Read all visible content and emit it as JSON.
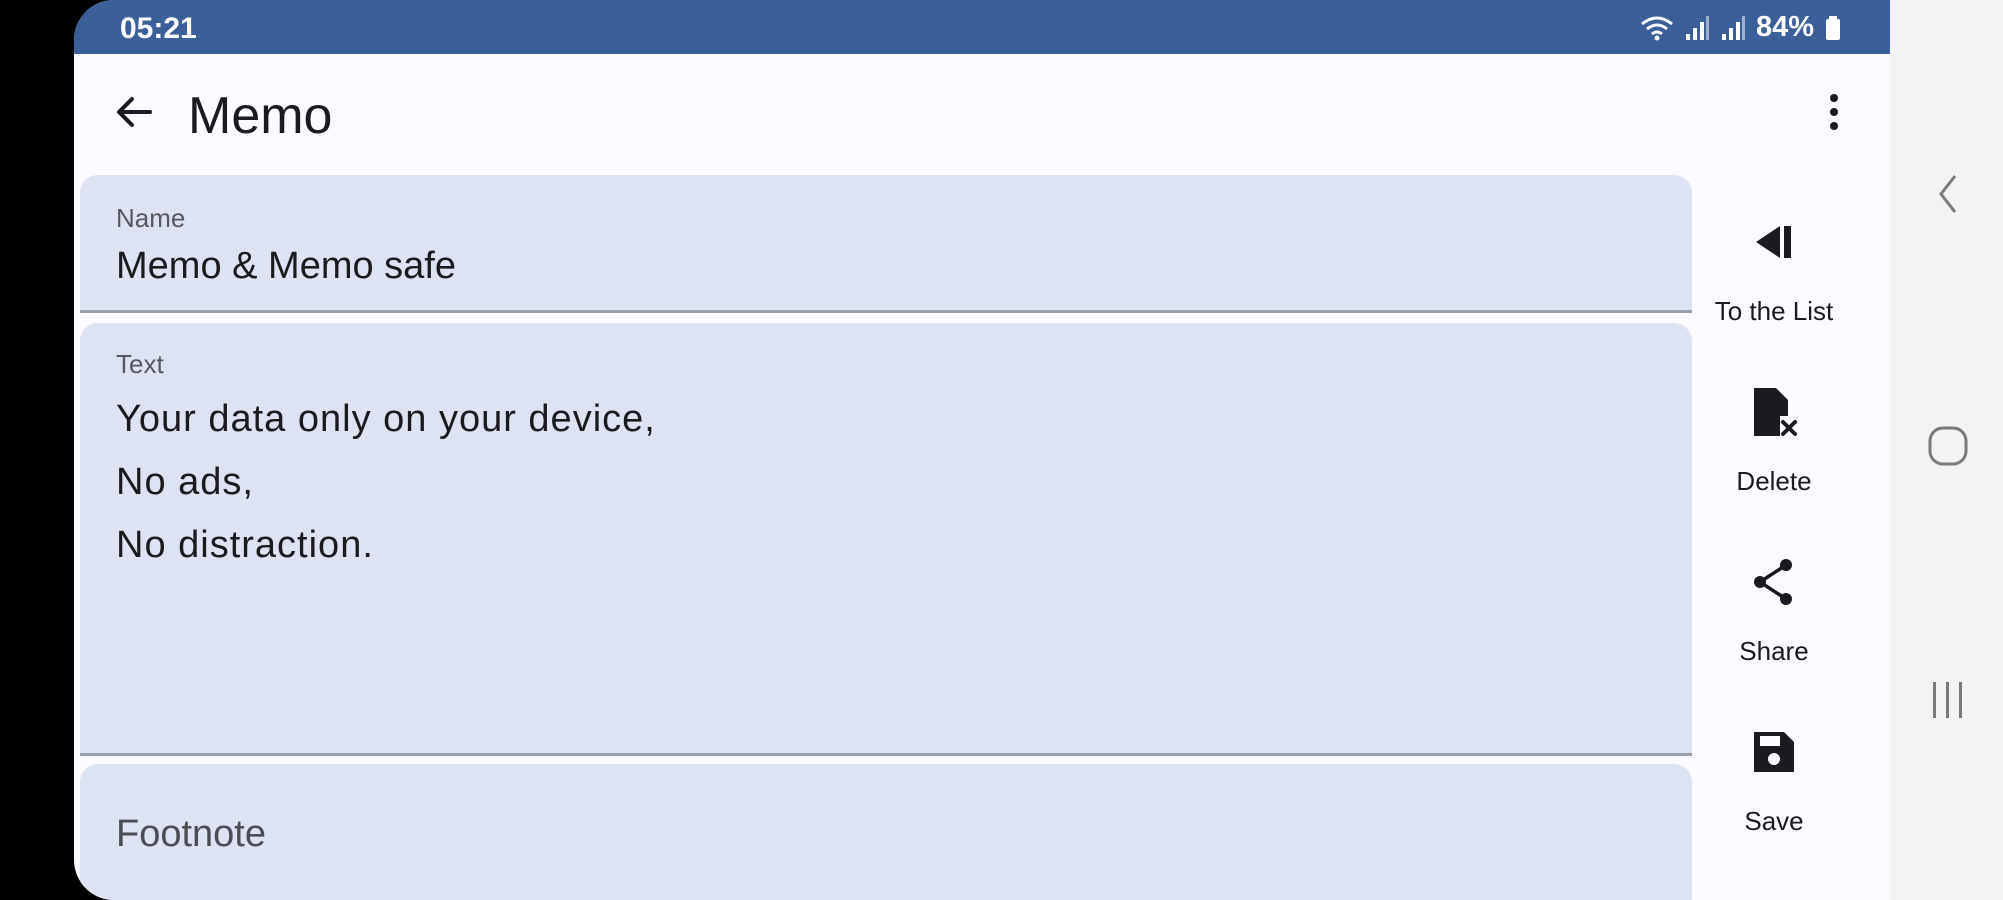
{
  "status_bar": {
    "time": "05:21",
    "battery": "84%",
    "color": "#3b5f98",
    "icons": [
      "wifi-icon",
      "signal-icon",
      "signal-icon",
      "battery-icon"
    ]
  },
  "app_bar": {
    "title": "Memo",
    "back_icon": "arrow-back-icon",
    "menu_icon": "more-vert-icon"
  },
  "form": {
    "name": {
      "label": "Name",
      "value": "Memo & Memo safe"
    },
    "text": {
      "label": "Text",
      "lines": [
        "Your data only on your device,",
        "No ads,",
        "No distraction."
      ]
    },
    "footnote": {
      "placeholder": "Footnote"
    }
  },
  "actions": [
    {
      "label": "To the List",
      "icon": "skip-back-icon"
    },
    {
      "label": "Delete",
      "icon": "delete-file-icon"
    },
    {
      "label": "Share",
      "icon": "share-icon"
    },
    {
      "label": "Save",
      "icon": "save-icon"
    }
  ],
  "navigation": [
    "back-nav-icon",
    "home-nav-icon",
    "recents-nav-icon"
  ],
  "colors": {
    "field_bg": "#dde3f2",
    "surface": "#fcfbff",
    "nav_bg": "#f3f3f3"
  }
}
